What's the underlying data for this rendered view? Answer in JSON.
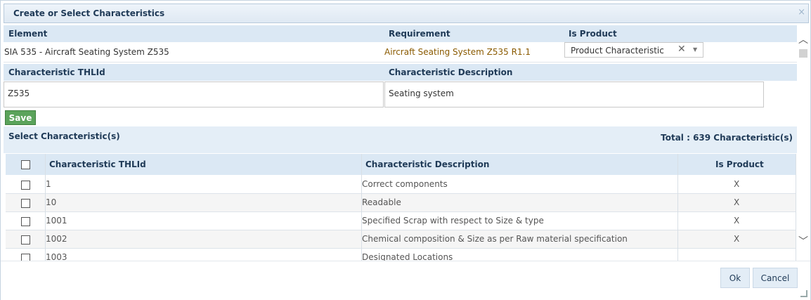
{
  "dialog": {
    "title": "Create or Select Characteristics",
    "close_glyph": "×"
  },
  "form": {
    "element_label": "Element",
    "requirement_label": "Requirement",
    "is_product_label": "Is Product",
    "element_value": "SIA 535 - Aircraft Seating System Z535",
    "requirement_value": "Aircraft Seating System Z535 R1.1",
    "is_product_value": "Product Characteristic",
    "char_thlid_label": "Characteristic THLId",
    "char_desc_label": "Characteristic Description",
    "char_thlid_value": "Z535",
    "char_desc_value": "Seating system",
    "save_label": "Save"
  },
  "select_section": {
    "title": "Select Characteristic(s)",
    "total": "Total : 639 Characteristic(s)"
  },
  "table": {
    "headers": [
      "Characteristic THLId",
      "Characteristic Description",
      "Is Product"
    ],
    "rows": [
      {
        "id": "1",
        "desc": "Correct components",
        "is_product": "X"
      },
      {
        "id": "10",
        "desc": "Readable",
        "is_product": "X"
      },
      {
        "id": "1001",
        "desc": "Specified Scrap with respect to Size & type",
        "is_product": "X"
      },
      {
        "id": "1002",
        "desc": "Chemical composition & Size as per Raw material specification",
        "is_product": "X"
      },
      {
        "id": "1003",
        "desc": "Designated Locations",
        "is_product": ""
      }
    ]
  },
  "footer": {
    "ok_label": "Ok",
    "cancel_label": "Cancel"
  },
  "colors": {
    "save": "#5ba35b",
    "header_bg": "#dbe8f4",
    "title_text": "#1f3a57",
    "requirement_text": "#8a5a00"
  }
}
